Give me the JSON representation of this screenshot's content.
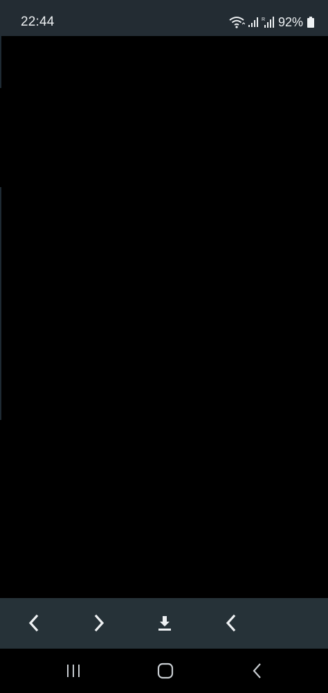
{
  "status_bar": {
    "time": "22:44",
    "battery_percent": "92%",
    "icons": [
      "wifi-icon",
      "signal-icon",
      "roaming-signal-icon",
      "battery-icon"
    ]
  },
  "toolbar": {
    "buttons": [
      {
        "icon": "chevron-left-icon"
      },
      {
        "icon": "chevron-right-icon"
      },
      {
        "icon": "download-icon"
      },
      {
        "icon": "chevron-left-icon"
      }
    ]
  },
  "navbar": {
    "buttons": [
      {
        "icon": "recent-apps-icon"
      },
      {
        "icon": "home-icon"
      },
      {
        "icon": "back-icon"
      }
    ]
  },
  "colors": {
    "status_bar_bg": "#232c33",
    "toolbar_bg": "#263238",
    "content_bg": "#000000",
    "icon_color": "#eef1f3"
  }
}
